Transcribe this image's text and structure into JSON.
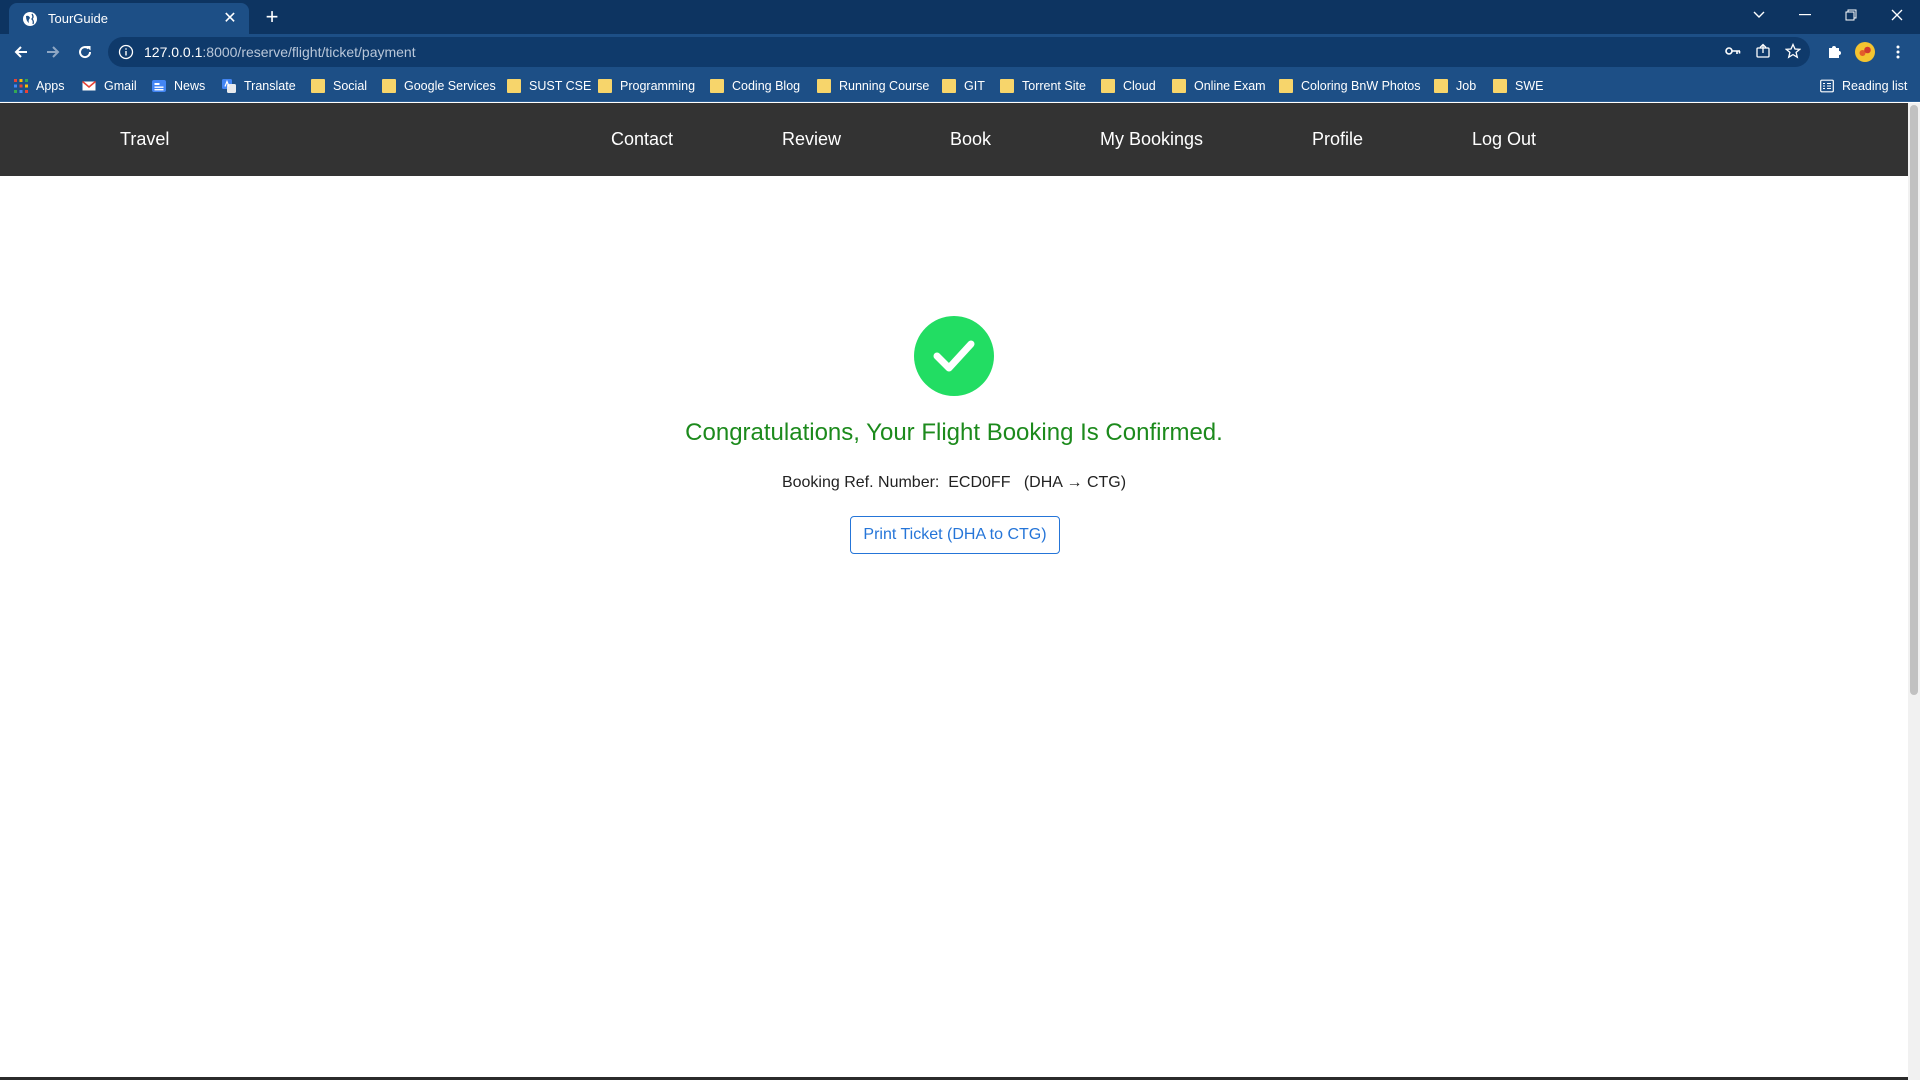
{
  "browser": {
    "tab_title": "TourGuide",
    "address": {
      "host": "127.0.0.1",
      "path": ":8000/reserve/flight/ticket/payment"
    },
    "bookmarks": [
      {
        "label": "Apps",
        "icon": "apps-grid-icon"
      },
      {
        "label": "Gmail",
        "icon": "gmail-icon"
      },
      {
        "label": "News",
        "icon": "news-icon"
      },
      {
        "label": "Translate",
        "icon": "translate-icon"
      },
      {
        "label": "Social",
        "icon": "folder-icon"
      },
      {
        "label": "Google Services",
        "icon": "folder-icon"
      },
      {
        "label": "SUST CSE",
        "icon": "folder-icon"
      },
      {
        "label": "Programming",
        "icon": "folder-icon"
      },
      {
        "label": "Coding Blog",
        "icon": "folder-icon"
      },
      {
        "label": "Running Course",
        "icon": "folder-icon"
      },
      {
        "label": "GIT",
        "icon": "folder-icon"
      },
      {
        "label": "Torrent Site",
        "icon": "folder-icon"
      },
      {
        "label": "Cloud",
        "icon": "folder-icon"
      },
      {
        "label": "Online Exam",
        "icon": "folder-icon"
      },
      {
        "label": "Coloring BnW Photos",
        "icon": "folder-icon"
      },
      {
        "label": "Job",
        "icon": "folder-icon"
      },
      {
        "label": "SWE",
        "icon": "folder-icon"
      }
    ],
    "reading_list": "Reading list",
    "colors": {
      "tabstrip": "#0d3461",
      "toolbar": "#1d4f86"
    }
  },
  "nav": {
    "brand": "Travel",
    "links": [
      "Contact",
      "Review",
      "Book",
      "My Bookings",
      "Profile",
      "Log Out"
    ]
  },
  "confirmation": {
    "headline": "Congratulations, Your Flight Booking Is Confirmed.",
    "ref_label": "Booking Ref. Number:",
    "ref_number": "ECD0FF",
    "route": "(DHA → CTG)",
    "print_button": "Print Ticket (DHA to CTG)",
    "icon": "check-circle-icon",
    "colors": {
      "success": "#22dd63",
      "headline": "#1c8a1c",
      "button": "#2575d8",
      "navbar": "#333333"
    }
  }
}
